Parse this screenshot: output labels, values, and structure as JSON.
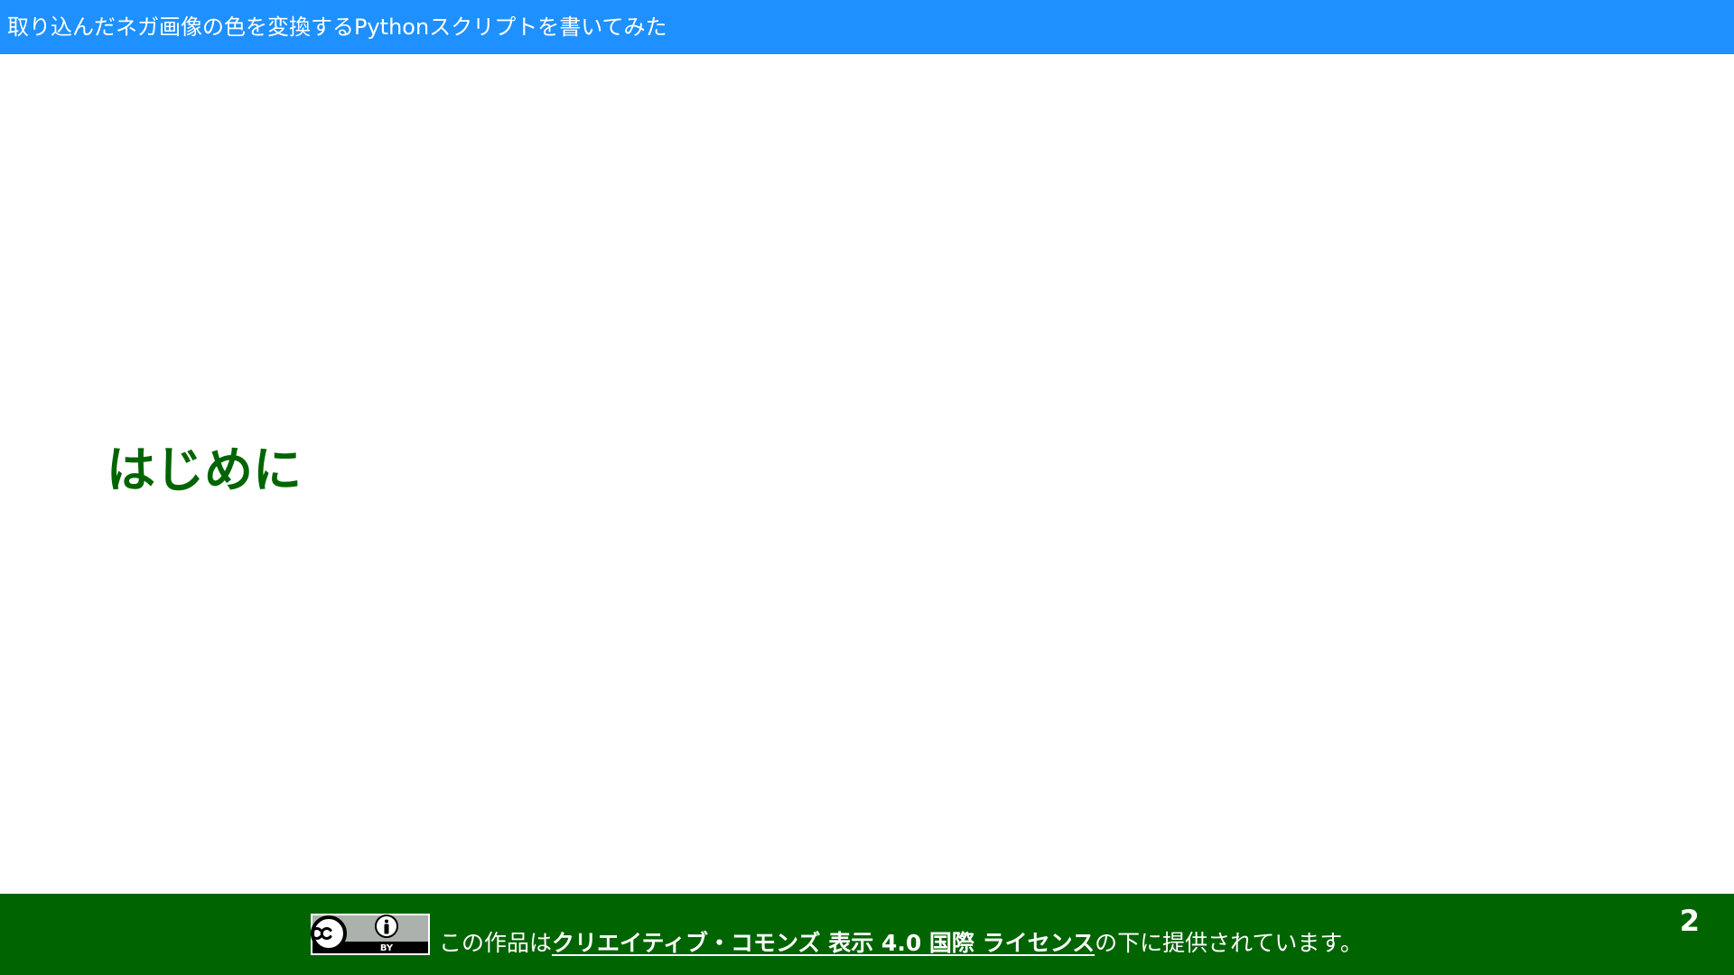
{
  "header": {
    "title": "取り込んだネガ画像の色を変換するPythonスクリプトを書いてみた"
  },
  "main": {
    "section_heading": "はじめに"
  },
  "footer": {
    "license_prefix": "この作品は",
    "license_link": "クリエイティブ・コモンズ 表示 4.0 国際 ライセンス",
    "license_suffix": "の下に提供されています。",
    "badge_label": "BY",
    "page_number": "2"
  },
  "colors": {
    "header_bg": "#1e90ff",
    "heading_text": "#006400",
    "footer_bg": "#006400"
  },
  "icons": {
    "license_badge": "cc-by-icon"
  }
}
